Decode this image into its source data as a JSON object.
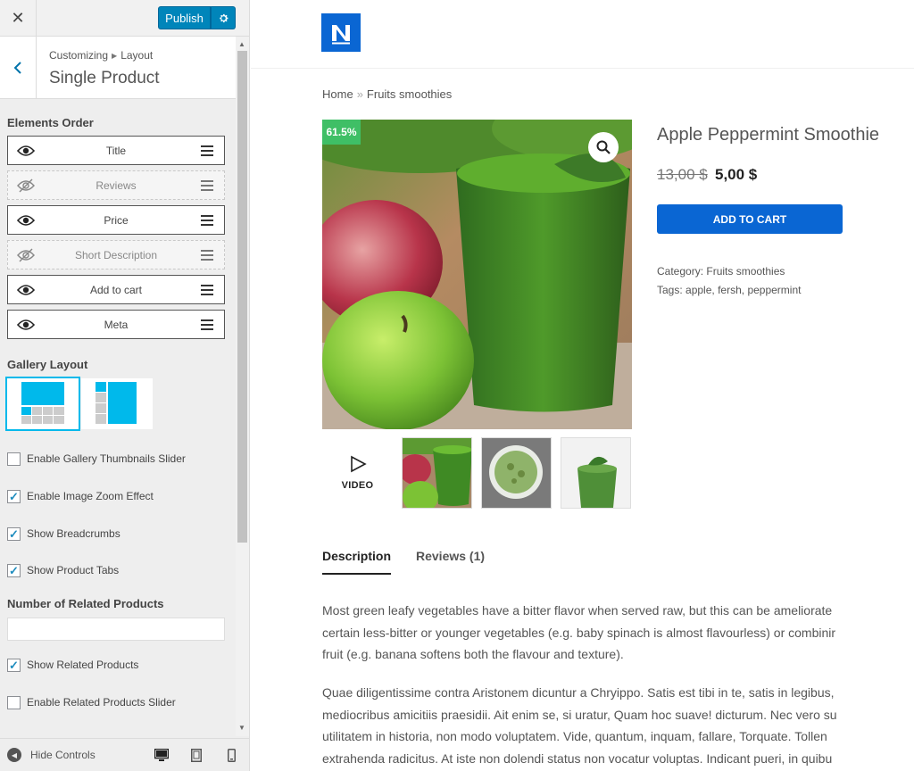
{
  "topbar": {
    "close_label": "✕",
    "publish_label": "Publish"
  },
  "section": {
    "breadcrumb_parent": "Customizing",
    "breadcrumb_child": "Layout",
    "title": "Single Product"
  },
  "elements_order": {
    "label": "Elements Order",
    "items": [
      {
        "label": "Title",
        "visible": true
      },
      {
        "label": "Reviews",
        "visible": false
      },
      {
        "label": "Price",
        "visible": true
      },
      {
        "label": "Short Description",
        "visible": false
      },
      {
        "label": "Add to cart",
        "visible": true
      },
      {
        "label": "Meta",
        "visible": true
      }
    ]
  },
  "gallery_layout": {
    "label": "Gallery Layout",
    "selected": "horizontal"
  },
  "checkboxes": [
    {
      "label": "Enable Gallery Thumbnails Slider",
      "checked": false
    },
    {
      "label": "Enable Image Zoom Effect",
      "checked": true
    },
    {
      "label": "Show Breadcrumbs",
      "checked": true
    },
    {
      "label": "Show Product Tabs",
      "checked": true
    }
  ],
  "related": {
    "label": "Number of Related Products",
    "value": "",
    "show_label": "Show Related Products",
    "show_checked": true,
    "slider_label": "Enable Related Products Slider",
    "slider_checked": false
  },
  "footer": {
    "hide_controls_label": "Hide Controls"
  },
  "preview": {
    "logo_letter": "N",
    "breadcrumbs": {
      "home": "Home",
      "separator": "»",
      "current": "Fruits smoothies"
    },
    "sale_badge": "61.5%",
    "product_title": "Apple Peppermint Smoothie",
    "price_old": "13,00 $",
    "price_new": "5,00 $",
    "add_to_cart": "ADD TO CART",
    "category_label": "Category:",
    "category_value": "Fruits smoothies",
    "tags_label": "Tags:",
    "tags": [
      "apple",
      "fersh",
      "peppermint"
    ],
    "video_label": "VIDEO",
    "tabs": [
      {
        "label": "Description"
      },
      {
        "label": "Reviews (1)"
      }
    ],
    "description": {
      "p1": [
        "Most green leafy vegetables have a bitter flavor when served raw, but this can be ameliorate",
        "certain less-bitter or younger vegetables (e.g. baby spinach is almost flavourless) or combinir",
        "fruit (e.g. banana softens both the flavour and texture)."
      ],
      "p2": [
        "Quae diligentissime contra Aristonem dicuntur a Chryippo. Satis est tibi in te, satis in legibus,",
        "mediocribus amicitiis praesidii. Ait enim se, si uratur, Quam hoc suave! dicturum. Nec vero su",
        "utilitatem in historia, non modo voluptatem. Vide, quantum, inquam, fallare, Torquate. Tollen",
        "extrahenda radicitus. At iste non dolendi status non vocatur voluptas. Indicant pueri, in quibu"
      ]
    }
  },
  "colors": {
    "primary_blue": "#0a66d3",
    "publish_blue": "#0085ba",
    "sale_green": "#3fbf66",
    "gallery_accent": "#00b9eb"
  }
}
